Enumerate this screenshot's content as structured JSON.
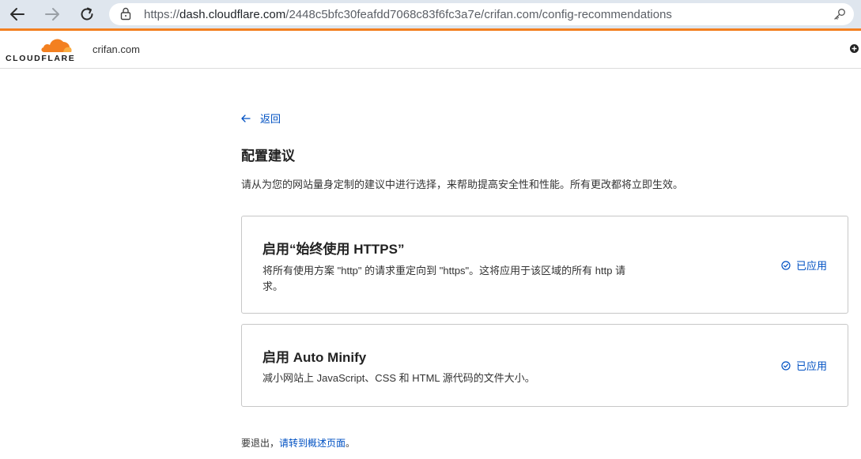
{
  "browser": {
    "url_scheme": "https://",
    "url_host": "dash.cloudflare.com",
    "url_path": "/2448c5bfc30feafdd7068c83f6fc3a7e/crifan.com/config-recommendations"
  },
  "header": {
    "logo_text": "CLOUDFLARE",
    "site_name": "crifan.com"
  },
  "main": {
    "back_label": "返回",
    "title": "配置建议",
    "description": "请从为您的网站量身定制的建议中进行选择，来帮助提高安全性和性能。所有更改都将立即生效。",
    "cards": [
      {
        "title": "启用“始终使用 HTTPS”",
        "description": "将所有使用方案 \"http\" 的请求重定向到 \"https\"。这将应用于该区域的所有 http 请求。",
        "status": "已应用"
      },
      {
        "title": "启用 Auto Minify",
        "description": "减小网站上 JavaScript、CSS 和 HTML 源代码的文件大小。",
        "status": "已应用"
      }
    ],
    "footer_prefix": "要退出，",
    "footer_link": "请转到概述页面",
    "footer_suffix": "。"
  },
  "colors": {
    "brand_orange": "#f38020",
    "link_blue": "#0051c3",
    "chrome_bg": "#dfe6ee"
  }
}
